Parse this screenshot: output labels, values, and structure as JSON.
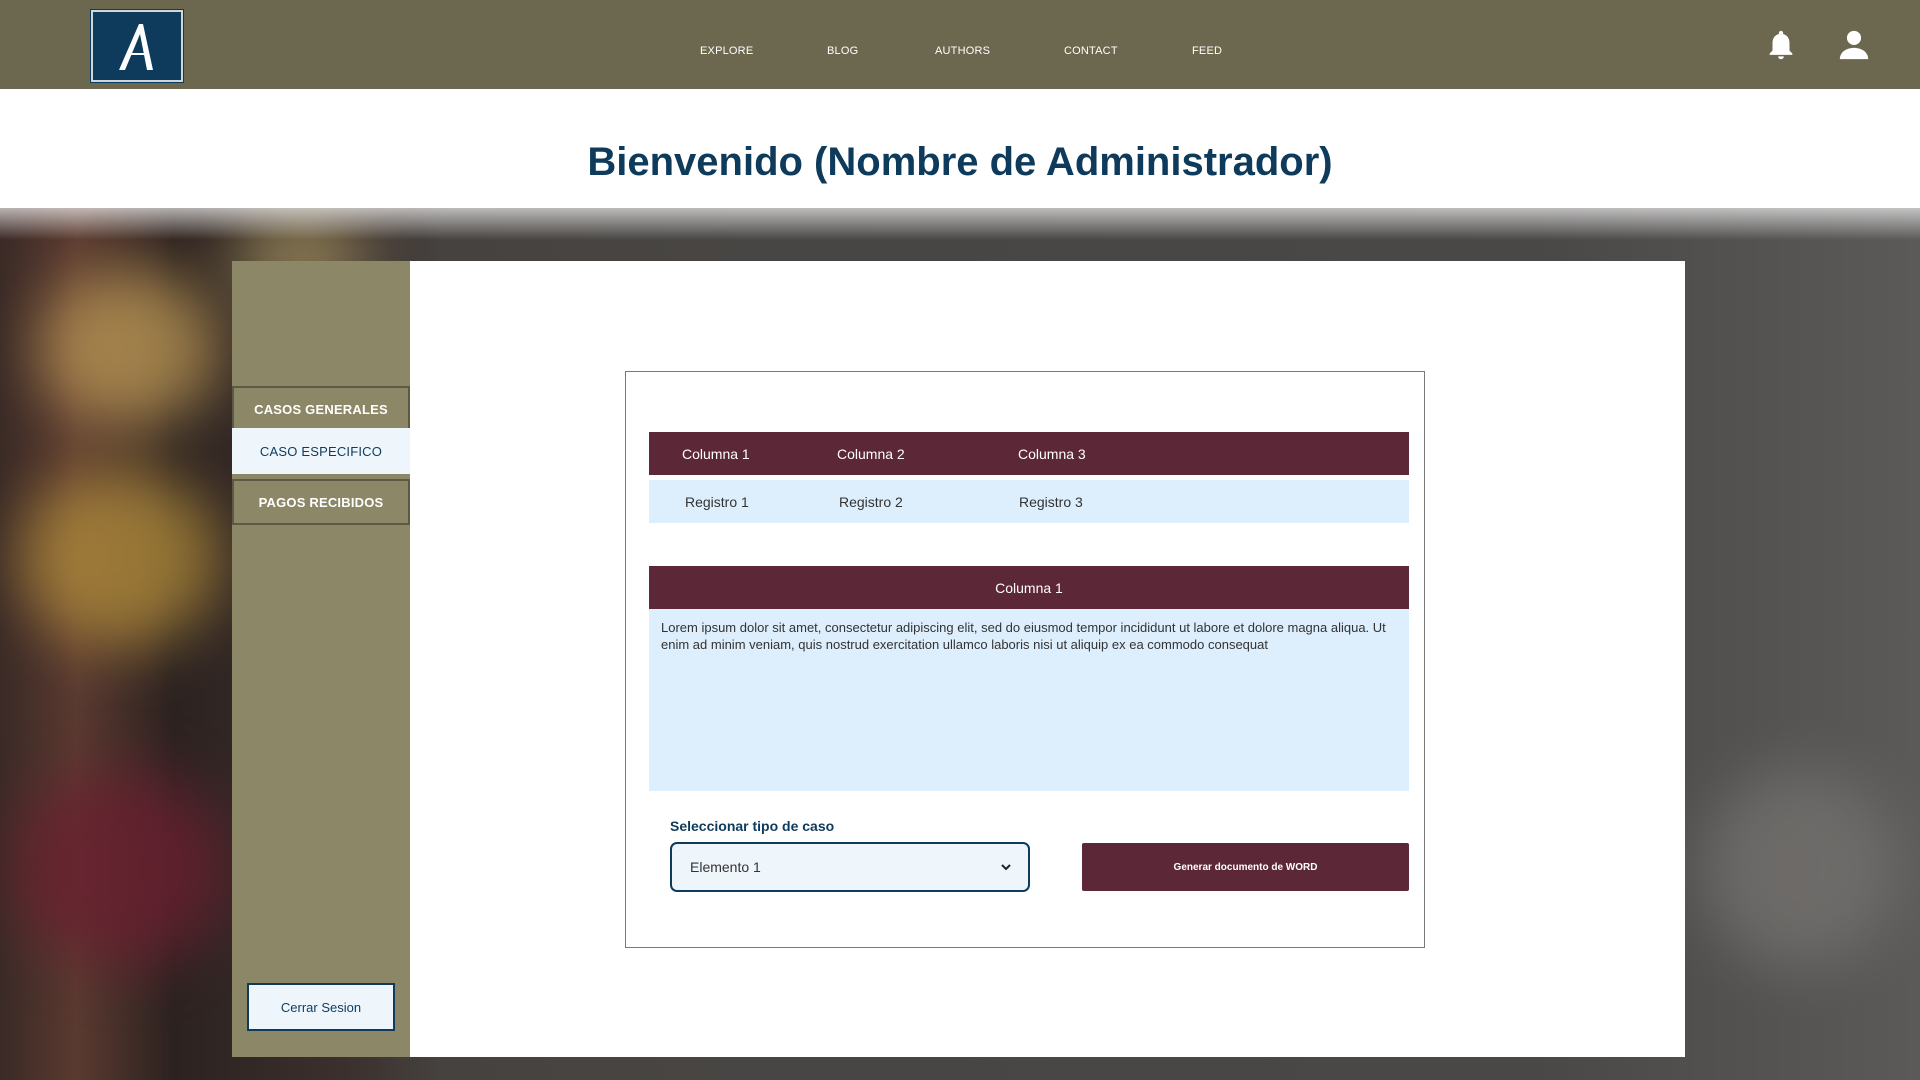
{
  "nav": {
    "logo_letter": "A",
    "items": [
      "EXPLORE",
      "BLOG",
      "AUTHORS",
      "CONTACT",
      "FEED"
    ],
    "icons": [
      "bell-icon",
      "user-icon"
    ]
  },
  "welcome": "Bienvenido (Nombre de Administrador)",
  "sidebar": {
    "items": [
      {
        "label": "CASOS GENERALES",
        "active": false
      },
      {
        "label": "CASO ESPECIFICO",
        "active": true
      },
      {
        "label": "PAGOS RECIBIDOS",
        "active": false
      }
    ],
    "logout_label": "Cerrar Sesion"
  },
  "table": {
    "headers": [
      "Columna 1",
      "Columna 2",
      "Columna 3"
    ],
    "row": [
      "Registro 1",
      "Registro 2",
      "Registro 3"
    ]
  },
  "description": {
    "header": "Columna 1",
    "text": "Lorem ipsum dolor sit amet, consectetur adipiscing elit, sed do eiusmod tempor incididunt ut labore et dolore magna aliqua. Ut enim ad minim veniam, quis nostrud exercitation ullamco laboris nisi ut aliquip ex ea commodo consequat"
  },
  "form": {
    "select_label": "Seleccionar tipo de caso",
    "select_value": "Elemento 1",
    "generate_label": "Generar documento de WORD"
  },
  "colors": {
    "topbar": "#6c684f",
    "sidebar": "#8c8766",
    "accent": "#5c2838",
    "navy": "#0e3b5c",
    "light": "#ddeefc"
  }
}
